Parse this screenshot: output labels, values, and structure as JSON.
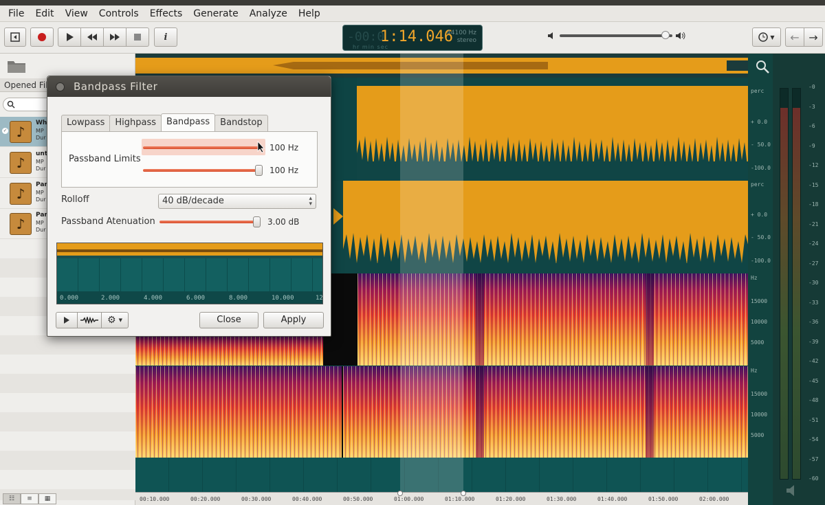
{
  "menubar": {
    "items": [
      "File",
      "Edit",
      "View",
      "Controls",
      "Effects",
      "Generate",
      "Analyze",
      "Help"
    ]
  },
  "toolbar": {
    "lcd": {
      "time": "1:14.046",
      "ghost": "-00:0",
      "units": "hr   min sec",
      "rate": "44100 Hz",
      "channels": "stereo"
    },
    "volume_level": 0.94,
    "icons": [
      "close-file-icon",
      "record-icon",
      "play-icon",
      "rewind-icon",
      "fast-forward-icon",
      "stop-icon",
      "info-icon",
      "volume-low-icon",
      "volume-high-icon",
      "clock-icon",
      "back-arrow-icon",
      "forward-arrow-icon"
    ]
  },
  "sidebar": {
    "header": "Opened Fil",
    "files": [
      {
        "name": "Wh",
        "format": "MP",
        "duration": "Dur",
        "active": true
      },
      {
        "name": "unt",
        "format": "MP",
        "duration": "Dur",
        "active": false
      },
      {
        "name": "Par",
        "format": "MP",
        "duration": "Dur",
        "active": false
      },
      {
        "name": "Par",
        "format": "MP",
        "duration": "Dur",
        "active": false
      }
    ]
  },
  "wave_scale": {
    "top": [
      "perc",
      "+ 0.0",
      "- 50.0",
      "-100.0"
    ],
    "bottom": [
      "perc",
      "+ 0.0",
      "- 50.0",
      "-100.0"
    ]
  },
  "spec_scale": {
    "top": [
      "Hz",
      "15000",
      "10000",
      "5000"
    ],
    "bottom": [
      "Hz",
      "15000",
      "10000",
      "5000"
    ]
  },
  "meter_scale": [
    "-0",
    "-3",
    "-6",
    "-9",
    "-12",
    "-15",
    "-18",
    "-21",
    "-24",
    "-27",
    "-30",
    "-33",
    "-36",
    "-39",
    "-42",
    "-45",
    "-48",
    "-51",
    "-54",
    "-57",
    "-60"
  ],
  "timeline": [
    "00:10.000",
    "00:20.000",
    "00:30.000",
    "00:40.000",
    "00:50.000",
    "01:00.000",
    "01:10.000",
    "01:20.000",
    "01:30.000",
    "01:40.000",
    "01:50.000",
    "02:00.000"
  ],
  "dialog": {
    "title": "Bandpass Filter",
    "tabs": [
      "Lowpass",
      "Highpass",
      "Bandpass",
      "Bandstop"
    ],
    "active_tab": "Bandpass",
    "passband_label": "Passband Limits",
    "limit1_value": "100 Hz",
    "limit2_value": "100 Hz",
    "rolloff_label": "Rolloff",
    "rolloff_value": "40 dB/decade",
    "attenuation_label": "Passband Atenuation",
    "attenuation_value": "3.00 dB",
    "preview_axis": [
      "0.000",
      "2.000",
      "4.000",
      "6.000",
      "8.000",
      "10.000",
      "12"
    ],
    "close_label": "Close",
    "apply_label": "Apply"
  },
  "colors": {
    "waveform": "#e59c1a",
    "track_bg": "#0d4a4a",
    "accent_slider": "#d84f2e"
  }
}
